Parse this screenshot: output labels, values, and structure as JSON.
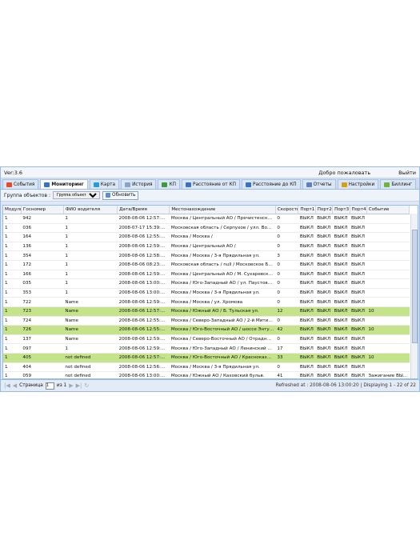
{
  "header": {
    "version": "Ver:3.6",
    "welcome": "Добро пожаловать",
    "logout": "Выйти"
  },
  "tabs": [
    {
      "label": "События",
      "icon": "events-icon",
      "color": "#e34d2b"
    },
    {
      "label": "Мониторинг",
      "icon": "monitoring-icon",
      "color": "#3a72c2"
    },
    {
      "label": "Карта",
      "icon": "map-icon",
      "color": "#2a9bd8"
    },
    {
      "label": "История",
      "icon": "history-icon",
      "color": "#8aa4c8"
    },
    {
      "label": "КП",
      "icon": "kp-icon",
      "color": "#3f9a3f"
    },
    {
      "label": "Расстояние от КП",
      "icon": "distance-from-icon",
      "color": "#3a72c2"
    },
    {
      "label": "Расстояние до КП",
      "icon": "distance-to-icon",
      "color": "#3a72c2"
    },
    {
      "label": "Отчеты",
      "icon": "reports-icon",
      "color": "#5f7fbf"
    },
    {
      "label": "Настройки",
      "icon": "settings-icon",
      "color": "#d4a017"
    },
    {
      "label": "Биллинг",
      "icon": "billing-icon",
      "color": "#6fb33d"
    }
  ],
  "toolbar": {
    "group_label": "Группа объектов :",
    "group_placeholder": "Группа объект",
    "refresh": "Обновить"
  },
  "columns": [
    "Модуль",
    "Госномер",
    "ФИО водителя",
    "Дата/Время",
    "Местонахождение",
    "Скорость",
    "Порт1",
    "Порт2",
    "Порт3",
    "Порт4",
    "Событие"
  ],
  "rows": [
    {
      "highlight": false,
      "cells": [
        "1",
        "942",
        "1",
        "2008-08-06 12:57:24.89",
        "Москва / Центральный АО / Пречистенская наб",
        "0",
        "ВЫКЛ",
        "ВЫКЛ",
        "ВЫКЛ",
        "ВЫКЛ",
        ""
      ]
    },
    {
      "highlight": false,
      "cells": [
        "1",
        "036",
        "1",
        "2008-07-17 15:39:59.48",
        "Московская область / Серпухов / улл. Ворошило",
        "0",
        "ВЫКЛ",
        "ВЫКЛ",
        "ВЫКЛ",
        "ВЫКЛ",
        ""
      ]
    },
    {
      "highlight": false,
      "cells": [
        "1",
        "164",
        "1",
        "2008-08-06 12:55:50.35",
        "Москва / Москва /",
        "0",
        "ВЫКЛ",
        "ВЫКЛ",
        "ВЫКЛ",
        "ВЫКЛ",
        ""
      ]
    },
    {
      "highlight": false,
      "cells": [
        "1",
        "136",
        "1",
        "2008-08-06 12:59:59.66",
        "Москва / Центральный АО /",
        "0",
        "ВЫКЛ",
        "ВЫКЛ",
        "ВЫКЛ",
        "ВЫКЛ",
        ""
      ]
    },
    {
      "highlight": false,
      "cells": [
        "1",
        "354",
        "1",
        "2008-08-06 12:58:21.89",
        "Москва / Москва / 3-я Прядильная ул.",
        "3",
        "ВЫКЛ",
        "ВЫКЛ",
        "ВЫКЛ",
        "ВЫКЛ",
        ""
      ]
    },
    {
      "highlight": false,
      "cells": [
        "1",
        "172",
        "1",
        "2008-08-06 08:23:00.82",
        "Московская область / null / Московское Больщо",
        "0",
        "ВЫКЛ",
        "ВЫКЛ",
        "ВЫКЛ",
        "ВЫКЛ",
        ""
      ]
    },
    {
      "highlight": false,
      "cells": [
        "1",
        "166",
        "1",
        "2008-08-06 12:59:35.93",
        "Москва / Центральный АО / М. Сухаревская пл.",
        "0",
        "ВЫКЛ",
        "ВЫКЛ",
        "ВЫКЛ",
        "ВЫКЛ",
        ""
      ]
    },
    {
      "highlight": false,
      "cells": [
        "1",
        "035",
        "1",
        "2008-08-06 13:00:16.71",
        "Москва / Юго-Западный АО / ул. Паустовского",
        "0",
        "ВЫКЛ",
        "ВЫКЛ",
        "ВЫКЛ",
        "ВЫКЛ",
        ""
      ]
    },
    {
      "highlight": false,
      "cells": [
        "1",
        "353",
        "1",
        "2008-08-06 13:00:16.90",
        "Москва / Москва / 3-я Прядильная ул.",
        "0",
        "ВЫКЛ",
        "ВЫКЛ",
        "ВЫКЛ",
        "ВЫКЛ",
        ""
      ]
    },
    {
      "highlight": false,
      "cells": [
        "1",
        "722",
        "Name",
        "2008-08-06 12:59:32.65",
        "Москва / Москва / ул. Хромова",
        "0",
        "ВЫКЛ",
        "ВЫКЛ",
        "ВЫКЛ",
        "ВЫКЛ",
        ""
      ]
    },
    {
      "highlight": true,
      "cells": [
        "1",
        "723",
        "Name",
        "2008-08-06 12:57:38.91",
        "Москва / Южный АО / Б. Тульская ул.",
        "12",
        "ВЫКЛ",
        "ВЫКЛ",
        "ВЫКЛ",
        "ВЫКЛ",
        "10"
      ]
    },
    {
      "highlight": false,
      "cells": [
        "1",
        "724",
        "Name",
        "2008-08-06 12:55:34.61",
        "Москва / Северо-Западный АО / 2-й Митинский",
        "0",
        "ВЫКЛ",
        "ВЫКЛ",
        "ВЫКЛ",
        "ВЫКЛ",
        ""
      ]
    },
    {
      "highlight": true,
      "cells": [
        "1",
        "726",
        "Name",
        "2008-08-06 12:55:33.92",
        "Москва / Юго-Восточный АО / шоссе Энтузиас",
        "42",
        "ВЫКЛ",
        "ВЫКЛ",
        "ВЫКЛ",
        "ВЫКЛ",
        "10"
      ]
    },
    {
      "highlight": false,
      "cells": [
        "1",
        "137",
        "Name",
        "2008-08-06 12:59:56.86",
        "Москва / Северо-Восточный АО / Отрадная ул.",
        "0",
        "ВЫКЛ",
        "ВЫКЛ",
        "ВЫКЛ",
        "ВЫКЛ",
        ""
      ]
    },
    {
      "highlight": false,
      "cells": [
        "1",
        "097",
        "1",
        "2008-08-06 12:59:34.75",
        "Москва / Юго-Западный АО / Ленинский просп.",
        "17",
        "ВЫКЛ",
        "ВЫКЛ",
        "ВЫКЛ",
        "ВЫКЛ",
        ""
      ]
    },
    {
      "highlight": true,
      "cells": [
        "1",
        "405",
        "not defined",
        "2008-08-06 12:57:46.16",
        "Москва / Юго-Восточный АО / Красноказармен",
        "33",
        "ВЫКЛ",
        "ВЫКЛ",
        "ВЫКЛ",
        "ВЫКЛ",
        "10"
      ]
    },
    {
      "highlight": false,
      "cells": [
        "1",
        "404",
        "not defined",
        "2008-08-06 12:56:22.64",
        "Москва / Москва / 3-я Прядильная ул.",
        "0",
        "ВЫКЛ",
        "ВЫКЛ",
        "ВЫКЛ",
        "ВЫКЛ",
        ""
      ]
    },
    {
      "highlight": false,
      "cells": [
        "1",
        "059",
        "not defined",
        "2008-08-06 13:00:08.34",
        "Москва / Южный АО / Каховский бульв.",
        "41",
        "ВЫКЛ",
        "ВЫКЛ",
        "ВЫКЛ",
        "ВЫКЛ",
        "Зажигание ВЫКЛ"
      ]
    }
  ],
  "pager": {
    "page_label": "Страница",
    "page_value": "1",
    "of_label": "из 1",
    "info": "Refreshed at : 2008-08-06 13:00:20 | Displaying 1 - 22 of 22"
  },
  "colors": {
    "highlight": "#c5e38a",
    "border": "#99bbe8"
  }
}
